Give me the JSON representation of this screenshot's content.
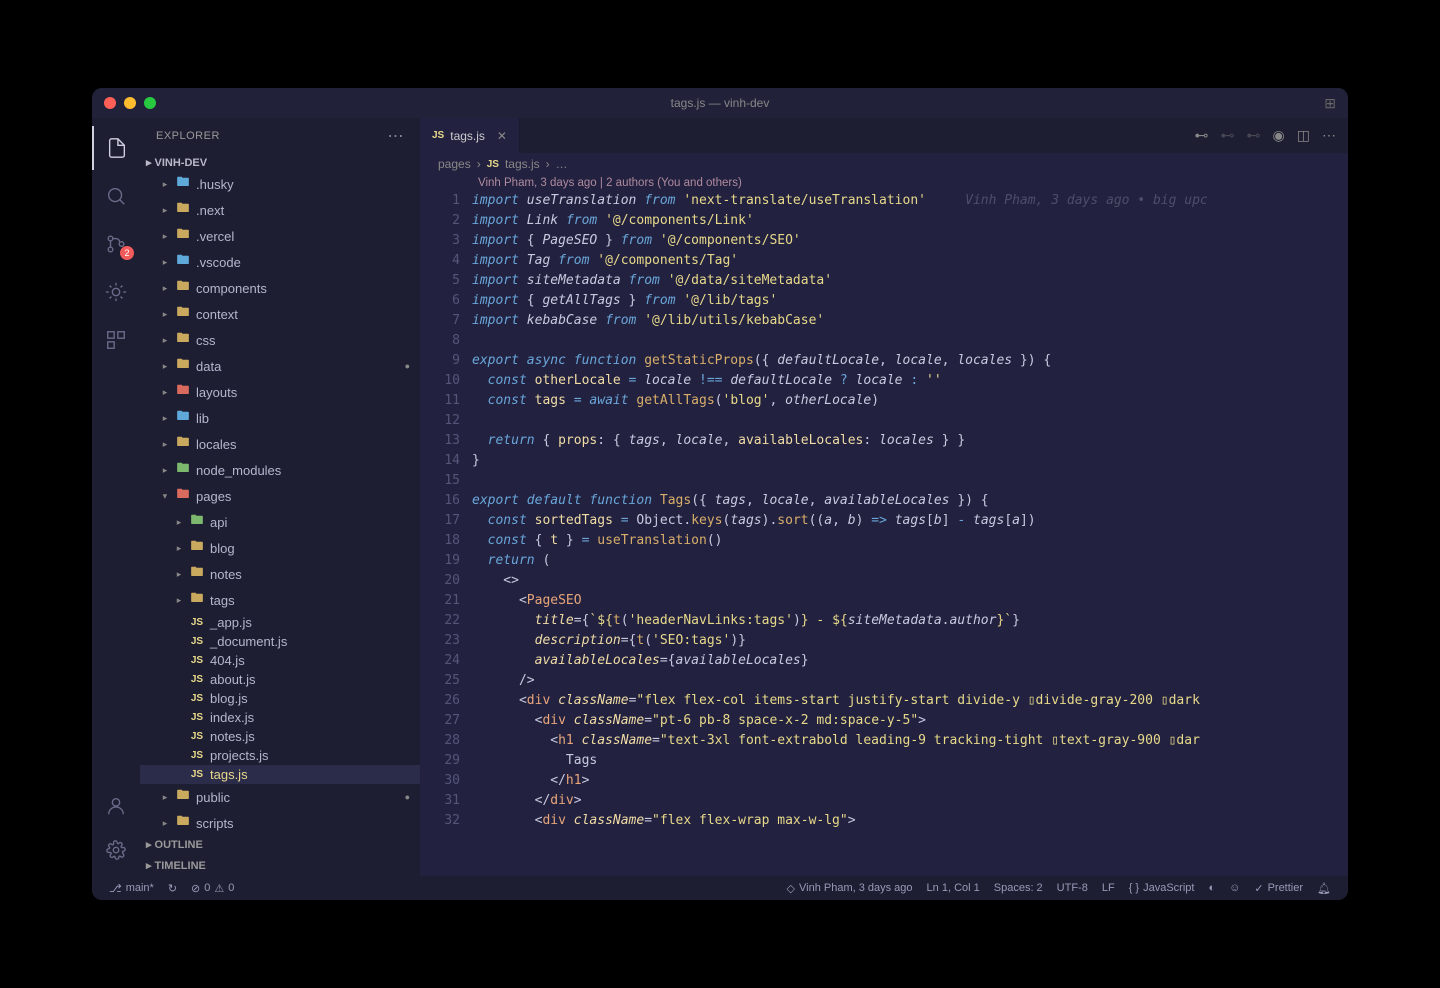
{
  "window": {
    "title": "tags.js — vinh-dev"
  },
  "sidebar": {
    "header": "EXPLORER",
    "project": "VINH-DEV",
    "outline": "OUTLINE",
    "timeline": "TIMELINE",
    "tree": [
      {
        "name": ".husky",
        "type": "folder",
        "level": 1,
        "color": "blue"
      },
      {
        "name": ".next",
        "type": "folder",
        "level": 1,
        "color": "default"
      },
      {
        "name": ".vercel",
        "type": "folder",
        "level": 1,
        "color": "default"
      },
      {
        "name": ".vscode",
        "type": "folder",
        "level": 1,
        "color": "blue"
      },
      {
        "name": "components",
        "type": "folder",
        "level": 1,
        "color": "default"
      },
      {
        "name": "context",
        "type": "folder",
        "level": 1,
        "color": "default"
      },
      {
        "name": "css",
        "type": "folder",
        "level": 1,
        "color": "default"
      },
      {
        "name": "data",
        "type": "folder",
        "level": 1,
        "color": "default",
        "dot": true
      },
      {
        "name": "layouts",
        "type": "folder",
        "level": 1,
        "color": "red"
      },
      {
        "name": "lib",
        "type": "folder",
        "level": 1,
        "color": "blue"
      },
      {
        "name": "locales",
        "type": "folder",
        "level": 1,
        "color": "default"
      },
      {
        "name": "node_modules",
        "type": "folder",
        "level": 1,
        "color": "green"
      },
      {
        "name": "pages",
        "type": "folder",
        "level": 1,
        "open": true,
        "color": "red"
      },
      {
        "name": "api",
        "type": "folder",
        "level": 2,
        "color": "green"
      },
      {
        "name": "blog",
        "type": "folder",
        "level": 2,
        "color": "default"
      },
      {
        "name": "notes",
        "type": "folder",
        "level": 2,
        "color": "default"
      },
      {
        "name": "tags",
        "type": "folder",
        "level": 2,
        "color": "default"
      },
      {
        "name": "_app.js",
        "type": "js",
        "level": 2
      },
      {
        "name": "_document.js",
        "type": "js",
        "level": 2
      },
      {
        "name": "404.js",
        "type": "js",
        "level": 2
      },
      {
        "name": "about.js",
        "type": "js",
        "level": 2
      },
      {
        "name": "blog.js",
        "type": "js",
        "level": 2
      },
      {
        "name": "index.js",
        "type": "js",
        "level": 2
      },
      {
        "name": "notes.js",
        "type": "js",
        "level": 2
      },
      {
        "name": "projects.js",
        "type": "js",
        "level": 2
      },
      {
        "name": "tags.js",
        "type": "js",
        "level": 2,
        "active": true
      },
      {
        "name": "public",
        "type": "folder",
        "level": 1,
        "color": "default",
        "dot": true
      },
      {
        "name": "scripts",
        "type": "folder",
        "level": 1,
        "color": "default"
      }
    ]
  },
  "scm_badge": "2",
  "tab": {
    "label": "tags.js",
    "icon": "JS"
  },
  "breadcrumb": {
    "folder": "pages",
    "file": "tags.js",
    "icon": "JS"
  },
  "codelens": "Vinh Pham, 3 days ago | 2 authors (You and others)",
  "inline_blame": "Vinh Pham, 3 days ago • big upc",
  "code": {
    "lines": [
      {
        "n": 1,
        "html": "<span class='k-import'>import</span> <span class='k-ident'>useTranslation</span> <span class='k-import'>from</span> <span class='k-string'>'next-translate/useTranslation'</span>"
      },
      {
        "n": 2,
        "html": "<span class='k-import'>import</span> <span class='k-ident'>Link</span> <span class='k-import'>from</span> <span class='k-string'>'@/components/Link'</span>"
      },
      {
        "n": 3,
        "html": "<span class='k-import'>import</span> { <span class='k-ident'>PageSEO</span> } <span class='k-import'>from</span> <span class='k-string'>'@/components/SEO'</span>"
      },
      {
        "n": 4,
        "html": "<span class='k-import'>import</span> <span class='k-ident'>Tag</span> <span class='k-import'>from</span> <span class='k-string'>'@/components/Tag'</span>"
      },
      {
        "n": 5,
        "html": "<span class='k-import'>import</span> <span class='k-ident'>siteMetadata</span> <span class='k-import'>from</span> <span class='k-string'>'@/data/siteMetadata'</span>"
      },
      {
        "n": 6,
        "html": "<span class='k-import'>import</span> { <span class='k-ident'>getAllTags</span> } <span class='k-import'>from</span> <span class='k-string'>'@/lib/tags'</span>"
      },
      {
        "n": 7,
        "html": "<span class='k-import'>import</span> <span class='k-ident'>kebabCase</span> <span class='k-import'>from</span> <span class='k-string'>'@/lib/utils/kebabCase'</span>"
      },
      {
        "n": 8,
        "html": ""
      },
      {
        "n": 9,
        "html": "<span class='k-keyword'>export</span> <span class='k-keyword'>async</span> <span class='k-keyword'>function</span> <span class='k-func'>getStaticProps</span>({ <span class='k-ident'>defaultLocale</span>, <span class='k-ident'>locale</span>, <span class='k-ident'>locales</span> }) {"
      },
      {
        "n": 10,
        "html": "  <span class='k-keyword'>const</span> <span class='k-const'>otherLocale</span> <span class='k-equal'>=</span> <span class='k-ident'>locale</span> <span class='k-equal'>!==</span> <span class='k-ident'>defaultLocale</span> <span class='k-equal'>?</span> <span class='k-ident'>locale</span> <span class='k-equal'>:</span> <span class='k-string'>''</span>"
      },
      {
        "n": 11,
        "html": "  <span class='k-keyword'>const</span> <span class='k-const'>tags</span> <span class='k-equal'>=</span> <span class='k-keyword'>await</span> <span class='k-func'>getAllTags</span>(<span class='k-string'>'blog'</span>, <span class='k-ident'>otherLocale</span>)"
      },
      {
        "n": 12,
        "html": ""
      },
      {
        "n": 13,
        "html": "  <span class='k-keyword'>return</span> { <span class='k-prop'>props</span>: { <span class='k-ident'>tags</span>, <span class='k-ident'>locale</span>, <span class='k-prop'>availableLocales</span>: <span class='k-ident'>locales</span> } }"
      },
      {
        "n": 14,
        "html": "}"
      },
      {
        "n": 15,
        "html": ""
      },
      {
        "n": 16,
        "html": "<span class='k-keyword'>export</span> <span class='k-keyword'>default</span> <span class='k-keyword'>function</span> <span class='k-func'>Tags</span>({ <span class='k-ident'>tags</span>, <span class='k-ident'>locale</span>, <span class='k-ident'>availableLocales</span> }) {"
      },
      {
        "n": 17,
        "html": "  <span class='k-keyword'>const</span> <span class='k-const'>sortedTags</span> <span class='k-equal'>=</span> Object.<span class='k-func'>keys</span>(<span class='k-ident'>tags</span>).<span class='k-func'>sort</span>((<span class='k-ident'>a</span>, <span class='k-ident'>b</span>) <span class='k-equal'>=&gt;</span> <span class='k-ident'>tags</span>[<span class='k-ident'>b</span>] <span class='k-equal'>-</span> <span class='k-ident'>tags</span>[<span class='k-ident'>a</span>])"
      },
      {
        "n": 18,
        "html": "  <span class='k-keyword'>const</span> { <span class='k-const'>t</span> } <span class='k-equal'>=</span> <span class='k-func'>useTranslation</span>()"
      },
      {
        "n": 19,
        "html": "  <span class='k-keyword'>return</span> ("
      },
      {
        "n": 20,
        "html": "    &lt;&gt;"
      },
      {
        "n": 21,
        "html": "      &lt;<span class='k-tag'>PageSEO</span>"
      },
      {
        "n": 22,
        "html": "        <span class='k-attr'>title</span>={<span class='k-string'>`${</span><span class='k-func'>t</span>(<span class='k-string'>'headerNavLinks:tags'</span>)<span class='k-string'>} - ${</span><span class='k-ident'>siteMetadata</span>.<span class='k-ident'>author</span><span class='k-string'>}`</span>}"
      },
      {
        "n": 23,
        "html": "        <span class='k-attr'>description</span>={<span class='k-func'>t</span>(<span class='k-string'>'SEO:tags'</span>)}"
      },
      {
        "n": 24,
        "html": "        <span class='k-attr'>availableLocales</span>={<span class='k-ident'>availableLocales</span>}"
      },
      {
        "n": 25,
        "html": "      /&gt;"
      },
      {
        "n": 26,
        "html": "      &lt;<span class='k-tag'>div</span> <span class='k-attr'>className</span>=<span class='k-string'>\"flex flex-col items-start justify-start divide-y ▯divide-gray-200 ▯dark</span>"
      },
      {
        "n": 27,
        "html": "        &lt;<span class='k-tag'>div</span> <span class='k-attr'>className</span>=<span class='k-string'>\"pt-6 pb-8 space-x-2 md:space-y-5\"</span>&gt;"
      },
      {
        "n": 28,
        "html": "          &lt;<span class='k-tag'>h1</span> <span class='k-attr'>className</span>=<span class='k-string'>\"text-3xl font-extrabold leading-9 tracking-tight ▯text-gray-900 ▯dar</span>"
      },
      {
        "n": 29,
        "html": "            Tags"
      },
      {
        "n": 30,
        "html": "          &lt;/<span class='k-tag'>h1</span>&gt;"
      },
      {
        "n": 31,
        "html": "        &lt;/<span class='k-tag'>div</span>&gt;"
      },
      {
        "n": 32,
        "html": "        &lt;<span class='k-tag'>div</span> <span class='k-attr'>className</span>=<span class='k-string'>\"flex flex-wrap max-w-lg\"</span>&gt;"
      }
    ]
  },
  "statusbar": {
    "branch": "main*",
    "errors": "0",
    "warnings": "0",
    "blame": "Vinh Pham, 3 days ago",
    "position": "Ln 1, Col 1",
    "spaces": "Spaces: 2",
    "encoding": "UTF-8",
    "eol": "LF",
    "lang": "JavaScript",
    "prettier": "Prettier"
  }
}
